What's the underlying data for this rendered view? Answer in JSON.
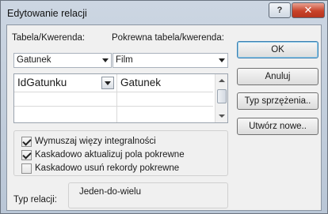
{
  "window": {
    "title": "Edytowanie relacji",
    "help_glyph": "?",
    "close_glyph": "✕"
  },
  "tables": {
    "table_label": "Tabela/Kwerenda:",
    "related_label": "Pokrewna tabela/kwerenda:",
    "table_value": "Gatunek",
    "related_value": "Film"
  },
  "fields": {
    "rows": [
      {
        "left": "IdGatunku",
        "right": "Gatunek"
      },
      {
        "left": "",
        "right": ""
      },
      {
        "left": "",
        "right": ""
      }
    ]
  },
  "options": {
    "enforce_integrity": {
      "label": "Wymuszaj więzy integralności",
      "checked": true
    },
    "cascade_update": {
      "label": "Kaskadowo aktualizuj pola pokrewne",
      "checked": true
    },
    "cascade_delete": {
      "label": "Kaskadowo usuń rekordy pokrewne",
      "checked": false
    }
  },
  "relation_type": {
    "label": "Typ relacji:",
    "value": "Jeden-do-wielu"
  },
  "buttons": {
    "ok": "OK",
    "cancel": "Anuluj",
    "join_type": "Typ sprzężenia..",
    "create_new": "Utwórz nowe.."
  }
}
